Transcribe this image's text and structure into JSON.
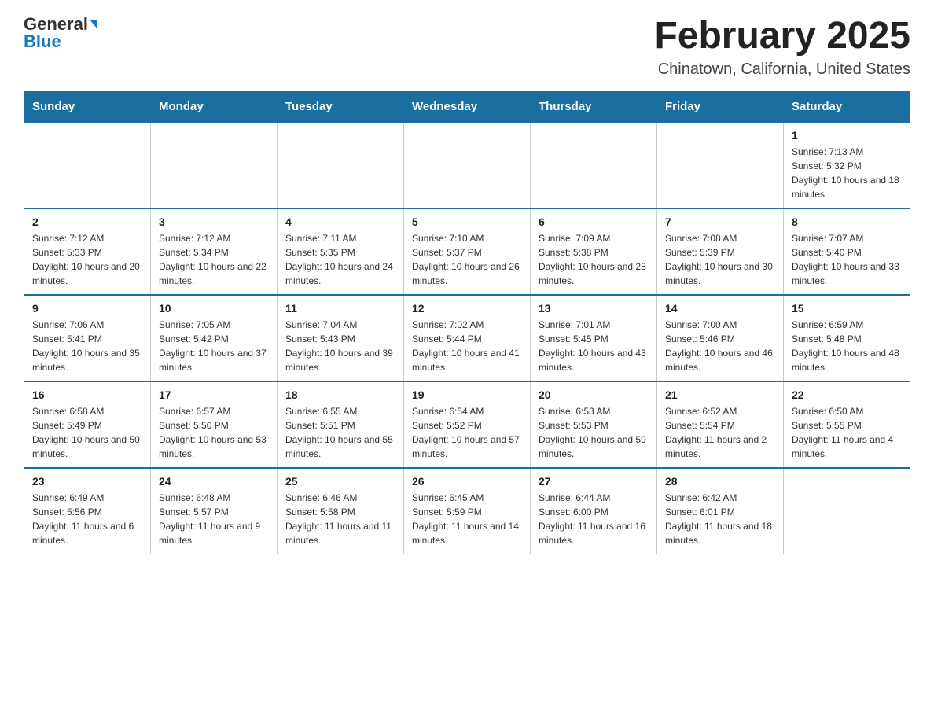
{
  "logo": {
    "general": "General",
    "blue": "Blue"
  },
  "title": "February 2025",
  "location": "Chinatown, California, United States",
  "weekdays": [
    "Sunday",
    "Monday",
    "Tuesday",
    "Wednesday",
    "Thursday",
    "Friday",
    "Saturday"
  ],
  "weeks": [
    [
      {
        "day": "",
        "info": ""
      },
      {
        "day": "",
        "info": ""
      },
      {
        "day": "",
        "info": ""
      },
      {
        "day": "",
        "info": ""
      },
      {
        "day": "",
        "info": ""
      },
      {
        "day": "",
        "info": ""
      },
      {
        "day": "1",
        "info": "Sunrise: 7:13 AM\nSunset: 5:32 PM\nDaylight: 10 hours and 18 minutes."
      }
    ],
    [
      {
        "day": "2",
        "info": "Sunrise: 7:12 AM\nSunset: 5:33 PM\nDaylight: 10 hours and 20 minutes."
      },
      {
        "day": "3",
        "info": "Sunrise: 7:12 AM\nSunset: 5:34 PM\nDaylight: 10 hours and 22 minutes."
      },
      {
        "day": "4",
        "info": "Sunrise: 7:11 AM\nSunset: 5:35 PM\nDaylight: 10 hours and 24 minutes."
      },
      {
        "day": "5",
        "info": "Sunrise: 7:10 AM\nSunset: 5:37 PM\nDaylight: 10 hours and 26 minutes."
      },
      {
        "day": "6",
        "info": "Sunrise: 7:09 AM\nSunset: 5:38 PM\nDaylight: 10 hours and 28 minutes."
      },
      {
        "day": "7",
        "info": "Sunrise: 7:08 AM\nSunset: 5:39 PM\nDaylight: 10 hours and 30 minutes."
      },
      {
        "day": "8",
        "info": "Sunrise: 7:07 AM\nSunset: 5:40 PM\nDaylight: 10 hours and 33 minutes."
      }
    ],
    [
      {
        "day": "9",
        "info": "Sunrise: 7:06 AM\nSunset: 5:41 PM\nDaylight: 10 hours and 35 minutes."
      },
      {
        "day": "10",
        "info": "Sunrise: 7:05 AM\nSunset: 5:42 PM\nDaylight: 10 hours and 37 minutes."
      },
      {
        "day": "11",
        "info": "Sunrise: 7:04 AM\nSunset: 5:43 PM\nDaylight: 10 hours and 39 minutes."
      },
      {
        "day": "12",
        "info": "Sunrise: 7:02 AM\nSunset: 5:44 PM\nDaylight: 10 hours and 41 minutes."
      },
      {
        "day": "13",
        "info": "Sunrise: 7:01 AM\nSunset: 5:45 PM\nDaylight: 10 hours and 43 minutes."
      },
      {
        "day": "14",
        "info": "Sunrise: 7:00 AM\nSunset: 5:46 PM\nDaylight: 10 hours and 46 minutes."
      },
      {
        "day": "15",
        "info": "Sunrise: 6:59 AM\nSunset: 5:48 PM\nDaylight: 10 hours and 48 minutes."
      }
    ],
    [
      {
        "day": "16",
        "info": "Sunrise: 6:58 AM\nSunset: 5:49 PM\nDaylight: 10 hours and 50 minutes."
      },
      {
        "day": "17",
        "info": "Sunrise: 6:57 AM\nSunset: 5:50 PM\nDaylight: 10 hours and 53 minutes."
      },
      {
        "day": "18",
        "info": "Sunrise: 6:55 AM\nSunset: 5:51 PM\nDaylight: 10 hours and 55 minutes."
      },
      {
        "day": "19",
        "info": "Sunrise: 6:54 AM\nSunset: 5:52 PM\nDaylight: 10 hours and 57 minutes."
      },
      {
        "day": "20",
        "info": "Sunrise: 6:53 AM\nSunset: 5:53 PM\nDaylight: 10 hours and 59 minutes."
      },
      {
        "day": "21",
        "info": "Sunrise: 6:52 AM\nSunset: 5:54 PM\nDaylight: 11 hours and 2 minutes."
      },
      {
        "day": "22",
        "info": "Sunrise: 6:50 AM\nSunset: 5:55 PM\nDaylight: 11 hours and 4 minutes."
      }
    ],
    [
      {
        "day": "23",
        "info": "Sunrise: 6:49 AM\nSunset: 5:56 PM\nDaylight: 11 hours and 6 minutes."
      },
      {
        "day": "24",
        "info": "Sunrise: 6:48 AM\nSunset: 5:57 PM\nDaylight: 11 hours and 9 minutes."
      },
      {
        "day": "25",
        "info": "Sunrise: 6:46 AM\nSunset: 5:58 PM\nDaylight: 11 hours and 11 minutes."
      },
      {
        "day": "26",
        "info": "Sunrise: 6:45 AM\nSunset: 5:59 PM\nDaylight: 11 hours and 14 minutes."
      },
      {
        "day": "27",
        "info": "Sunrise: 6:44 AM\nSunset: 6:00 PM\nDaylight: 11 hours and 16 minutes."
      },
      {
        "day": "28",
        "info": "Sunrise: 6:42 AM\nSunset: 6:01 PM\nDaylight: 11 hours and 18 minutes."
      },
      {
        "day": "",
        "info": ""
      }
    ]
  ]
}
